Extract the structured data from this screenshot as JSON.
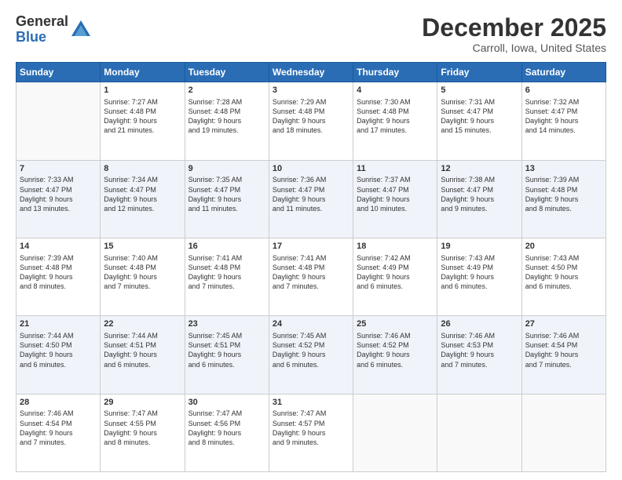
{
  "logo": {
    "general": "General",
    "blue": "Blue"
  },
  "header": {
    "month": "December 2025",
    "location": "Carroll, Iowa, United States"
  },
  "weekdays": [
    "Sunday",
    "Monday",
    "Tuesday",
    "Wednesday",
    "Thursday",
    "Friday",
    "Saturday"
  ],
  "weeks": [
    [
      {
        "day": "",
        "info": ""
      },
      {
        "day": "1",
        "info": "Sunrise: 7:27 AM\nSunset: 4:48 PM\nDaylight: 9 hours\nand 21 minutes."
      },
      {
        "day": "2",
        "info": "Sunrise: 7:28 AM\nSunset: 4:48 PM\nDaylight: 9 hours\nand 19 minutes."
      },
      {
        "day": "3",
        "info": "Sunrise: 7:29 AM\nSunset: 4:48 PM\nDaylight: 9 hours\nand 18 minutes."
      },
      {
        "day": "4",
        "info": "Sunrise: 7:30 AM\nSunset: 4:48 PM\nDaylight: 9 hours\nand 17 minutes."
      },
      {
        "day": "5",
        "info": "Sunrise: 7:31 AM\nSunset: 4:47 PM\nDaylight: 9 hours\nand 15 minutes."
      },
      {
        "day": "6",
        "info": "Sunrise: 7:32 AM\nSunset: 4:47 PM\nDaylight: 9 hours\nand 14 minutes."
      }
    ],
    [
      {
        "day": "7",
        "info": "Sunrise: 7:33 AM\nSunset: 4:47 PM\nDaylight: 9 hours\nand 13 minutes."
      },
      {
        "day": "8",
        "info": "Sunrise: 7:34 AM\nSunset: 4:47 PM\nDaylight: 9 hours\nand 12 minutes."
      },
      {
        "day": "9",
        "info": "Sunrise: 7:35 AM\nSunset: 4:47 PM\nDaylight: 9 hours\nand 11 minutes."
      },
      {
        "day": "10",
        "info": "Sunrise: 7:36 AM\nSunset: 4:47 PM\nDaylight: 9 hours\nand 11 minutes."
      },
      {
        "day": "11",
        "info": "Sunrise: 7:37 AM\nSunset: 4:47 PM\nDaylight: 9 hours\nand 10 minutes."
      },
      {
        "day": "12",
        "info": "Sunrise: 7:38 AM\nSunset: 4:47 PM\nDaylight: 9 hours\nand 9 minutes."
      },
      {
        "day": "13",
        "info": "Sunrise: 7:39 AM\nSunset: 4:48 PM\nDaylight: 9 hours\nand 8 minutes."
      }
    ],
    [
      {
        "day": "14",
        "info": "Sunrise: 7:39 AM\nSunset: 4:48 PM\nDaylight: 9 hours\nand 8 minutes."
      },
      {
        "day": "15",
        "info": "Sunrise: 7:40 AM\nSunset: 4:48 PM\nDaylight: 9 hours\nand 7 minutes."
      },
      {
        "day": "16",
        "info": "Sunrise: 7:41 AM\nSunset: 4:48 PM\nDaylight: 9 hours\nand 7 minutes."
      },
      {
        "day": "17",
        "info": "Sunrise: 7:41 AM\nSunset: 4:48 PM\nDaylight: 9 hours\nand 7 minutes."
      },
      {
        "day": "18",
        "info": "Sunrise: 7:42 AM\nSunset: 4:49 PM\nDaylight: 9 hours\nand 6 minutes."
      },
      {
        "day": "19",
        "info": "Sunrise: 7:43 AM\nSunset: 4:49 PM\nDaylight: 9 hours\nand 6 minutes."
      },
      {
        "day": "20",
        "info": "Sunrise: 7:43 AM\nSunset: 4:50 PM\nDaylight: 9 hours\nand 6 minutes."
      }
    ],
    [
      {
        "day": "21",
        "info": "Sunrise: 7:44 AM\nSunset: 4:50 PM\nDaylight: 9 hours\nand 6 minutes."
      },
      {
        "day": "22",
        "info": "Sunrise: 7:44 AM\nSunset: 4:51 PM\nDaylight: 9 hours\nand 6 minutes."
      },
      {
        "day": "23",
        "info": "Sunrise: 7:45 AM\nSunset: 4:51 PM\nDaylight: 9 hours\nand 6 minutes."
      },
      {
        "day": "24",
        "info": "Sunrise: 7:45 AM\nSunset: 4:52 PM\nDaylight: 9 hours\nand 6 minutes."
      },
      {
        "day": "25",
        "info": "Sunrise: 7:46 AM\nSunset: 4:52 PM\nDaylight: 9 hours\nand 6 minutes."
      },
      {
        "day": "26",
        "info": "Sunrise: 7:46 AM\nSunset: 4:53 PM\nDaylight: 9 hours\nand 7 minutes."
      },
      {
        "day": "27",
        "info": "Sunrise: 7:46 AM\nSunset: 4:54 PM\nDaylight: 9 hours\nand 7 minutes."
      }
    ],
    [
      {
        "day": "28",
        "info": "Sunrise: 7:46 AM\nSunset: 4:54 PM\nDaylight: 9 hours\nand 7 minutes."
      },
      {
        "day": "29",
        "info": "Sunrise: 7:47 AM\nSunset: 4:55 PM\nDaylight: 9 hours\nand 8 minutes."
      },
      {
        "day": "30",
        "info": "Sunrise: 7:47 AM\nSunset: 4:56 PM\nDaylight: 9 hours\nand 8 minutes."
      },
      {
        "day": "31",
        "info": "Sunrise: 7:47 AM\nSunset: 4:57 PM\nDaylight: 9 hours\nand 9 minutes."
      },
      {
        "day": "",
        "info": ""
      },
      {
        "day": "",
        "info": ""
      },
      {
        "day": "",
        "info": ""
      }
    ]
  ]
}
